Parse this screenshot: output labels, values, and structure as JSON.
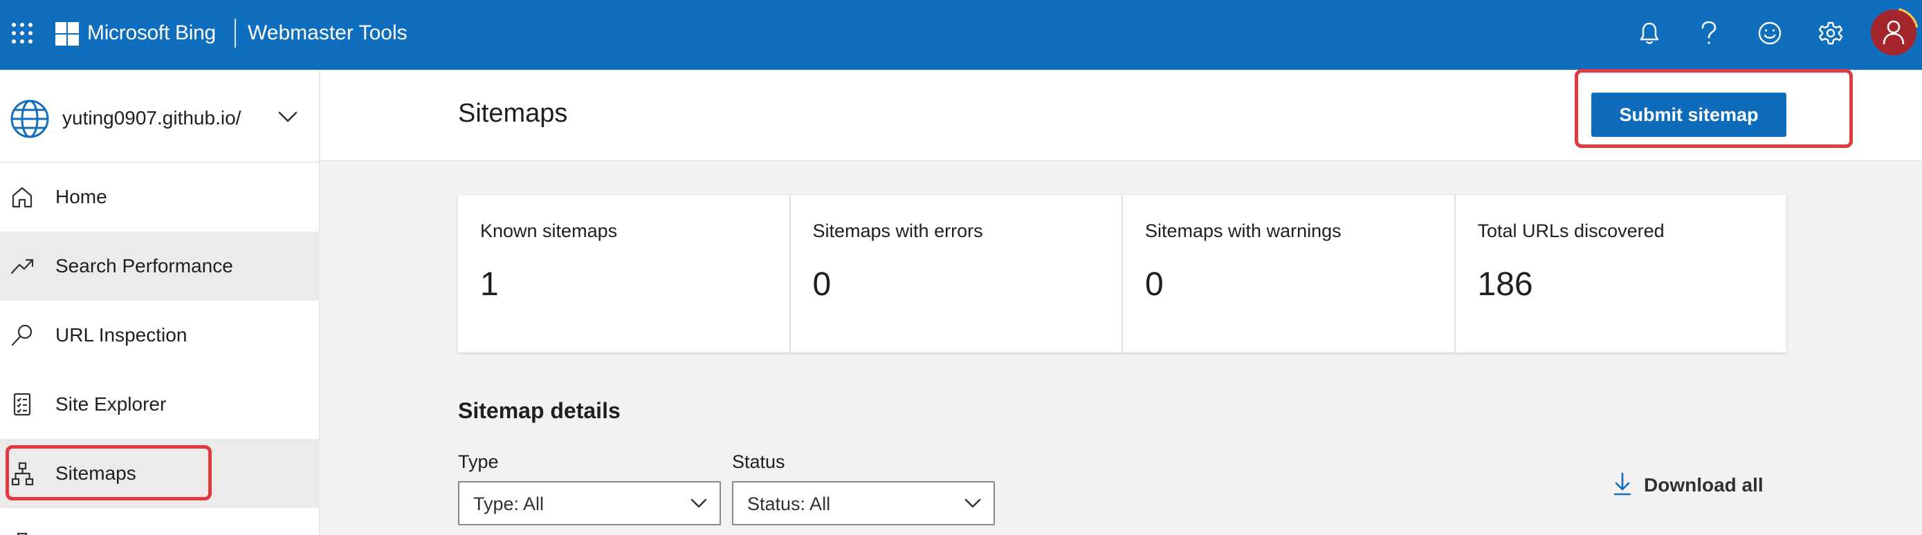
{
  "topbar": {
    "brand": "Microsoft Bing",
    "product": "Webmaster Tools",
    "icons": [
      "apps-waffle-icon",
      "notifications-bell-icon",
      "help-icon",
      "feedback-smiley-icon",
      "settings-gear-icon",
      "user-avatar-icon"
    ],
    "bg_color": "#106ebe",
    "avatar_color": "#a4262c"
  },
  "sidebar": {
    "site": "yuting0907.github.io/",
    "items": [
      {
        "label": "Home",
        "icon": "home-icon"
      },
      {
        "label": "Search Performance",
        "icon": "trend-up-icon"
      },
      {
        "label": "URL Inspection",
        "icon": "search-icon"
      },
      {
        "label": "Site Explorer",
        "icon": "checklist-icon"
      },
      {
        "label": "Sitemaps",
        "icon": "sitemap-icon",
        "active": true
      }
    ]
  },
  "main": {
    "title": "Sitemaps",
    "submit_label": "Submit sitemap",
    "stats": [
      {
        "label": "Known sitemaps",
        "value": "1"
      },
      {
        "label": "Sitemaps with errors",
        "value": "0"
      },
      {
        "label": "Sitemaps with warnings",
        "value": "0"
      },
      {
        "label": "Total URLs discovered",
        "value": "186"
      }
    ],
    "details_title": "Sitemap details",
    "filters": {
      "type_label": "Type",
      "type_value": "Type: All",
      "status_label": "Status",
      "status_value": "Status: All"
    },
    "download_label": "Download all",
    "accent_color": "#0f6cbd",
    "highlight_color": "#e0393e"
  }
}
